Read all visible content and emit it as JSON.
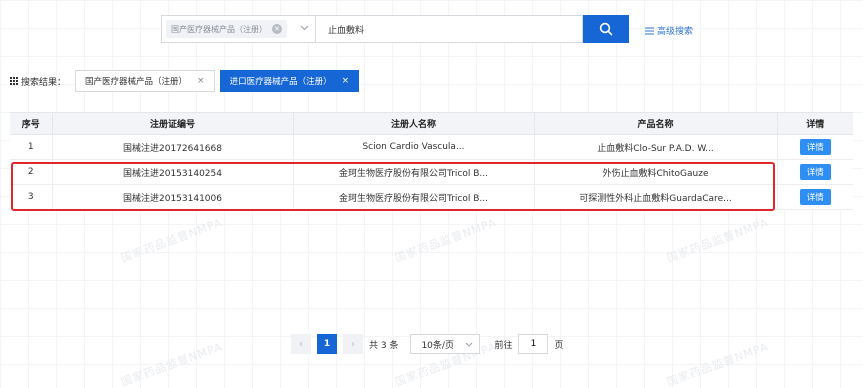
{
  "search": {
    "scope_tag": "国产医疗器械产品（注册）",
    "query": "止血敷料",
    "advanced_label": "高级搜索"
  },
  "results": {
    "label": "搜索结果：",
    "chips": [
      {
        "label": "国产医疗器械产品（注册）",
        "active": false
      },
      {
        "label": "进口医疗器械产品（注册）",
        "active": true
      }
    ]
  },
  "table": {
    "headers": [
      "序号",
      "注册证编号",
      "注册人名称",
      "产品名称",
      "详情"
    ],
    "rows": [
      {
        "no": "1",
        "cert": "国械注进20172641668",
        "registrant": "Scion Cardio Vascula...",
        "product": "止血敷料Clo-Sur P.A.D. W...",
        "detail": "详情"
      },
      {
        "no": "2",
        "cert": "国械注进20153140254",
        "registrant": "金珂生物医疗股份有限公司Tricol B...",
        "product": "外伤止血敷料ChitoGauze",
        "detail": "详情"
      },
      {
        "no": "3",
        "cert": "国械注进20153141006",
        "registrant": "金珂生物医疗股份有限公司Tricol B...",
        "product": "可探测性外科止血敷料GuardaCare...",
        "detail": "详情"
      }
    ]
  },
  "pagination": {
    "current_page": "1",
    "total": "共 3 条",
    "page_size": "10条/页",
    "goto_label": "前往",
    "goto_value": "1",
    "page_unit": "页"
  },
  "watermark": "国家药品监督NMPA"
}
